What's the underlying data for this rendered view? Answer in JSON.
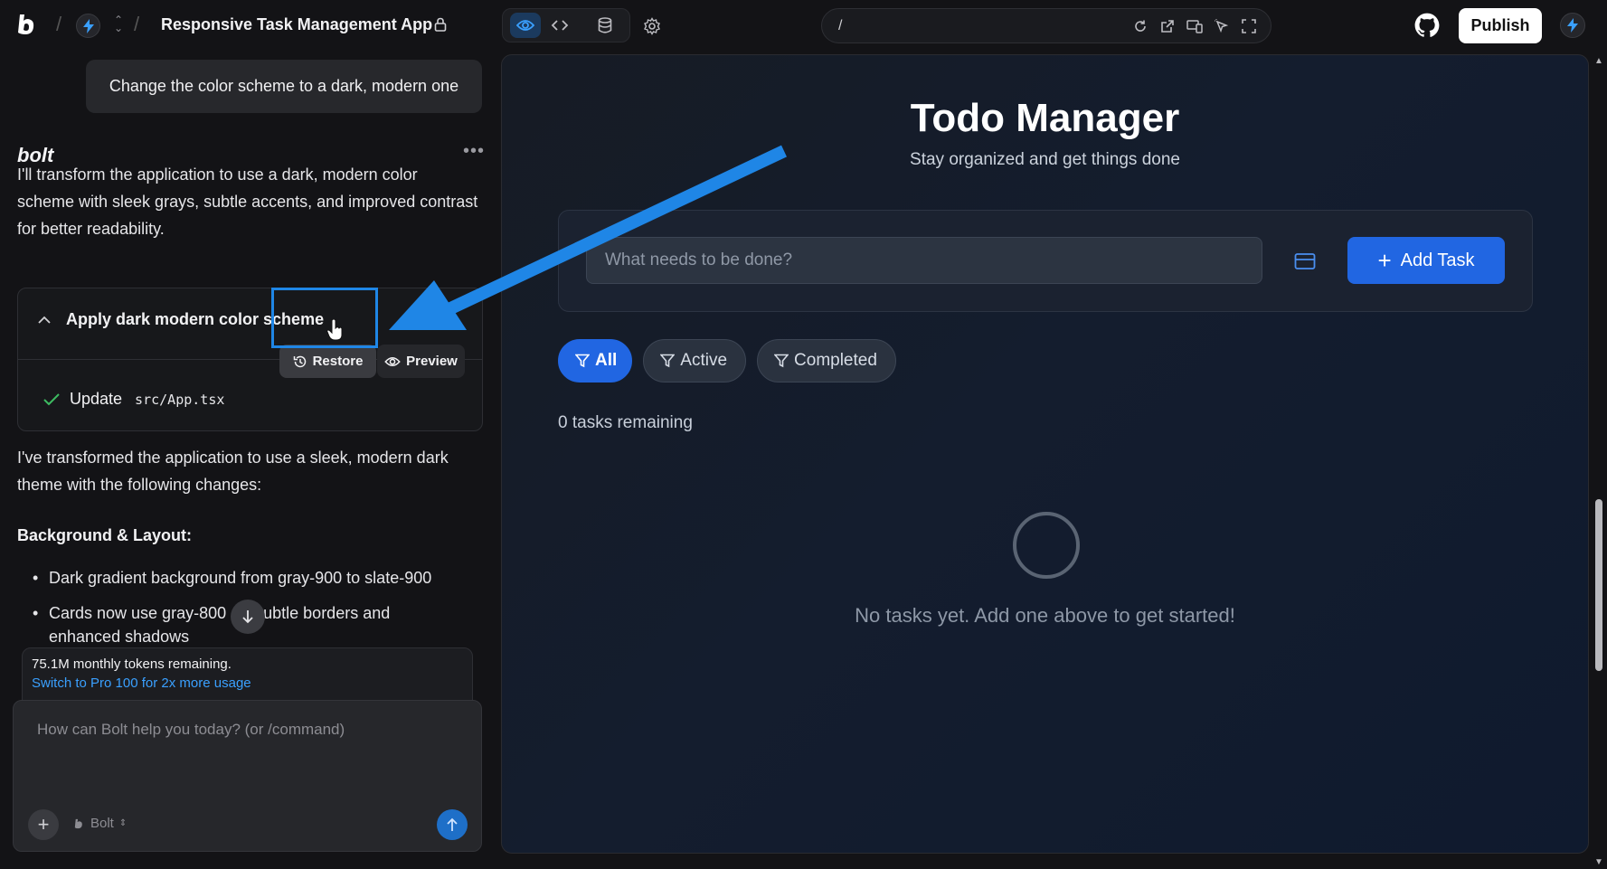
{
  "topbar": {
    "project_title": "Responsive Task Management App",
    "url": "/",
    "publish_label": "Publish"
  },
  "chat": {
    "user_message": "Change the color scheme to a dark, modern one",
    "assistant_name": "bolt",
    "intro": "I'll transform the application to use a dark, modern color scheme with sleek grays, subtle accents, and improved contrast for better readability.",
    "action": {
      "title": "Apply dark modern color scheme",
      "restore_label": "Restore",
      "preview_label": "Preview",
      "update_label": "Update",
      "update_path": "src/App.tsx"
    },
    "summary": "I've transformed the application to use a sleek, modern dark theme with the following changes:",
    "section_heading": "Background & Layout:",
    "bullets": [
      "Dark gradient background from gray-900 to slate-900",
      "Cards now use gray-800",
      "n subtle borders and",
      "enhanced shadows"
    ],
    "tokens_remaining": "75.1M monthly tokens remaining.",
    "upgrade_link": "Switch to Pro 100 for 2x more usage",
    "input_placeholder": "How can Bolt help you today? (or /command)",
    "model_name": "Bolt"
  },
  "app": {
    "title": "Todo Manager",
    "subtitle": "Stay organized and get things done",
    "task_placeholder": "What needs to be done?",
    "add_button": "Add Task",
    "filters": [
      {
        "label": "All",
        "active": true
      },
      {
        "label": "Active",
        "active": false
      },
      {
        "label": "Completed",
        "active": false
      }
    ],
    "remaining": "0 tasks remaining",
    "empty_message": "No tasks yet. Add one above to get started!"
  },
  "colors": {
    "accent": "#2166e2",
    "annotation": "#1f86e6"
  }
}
